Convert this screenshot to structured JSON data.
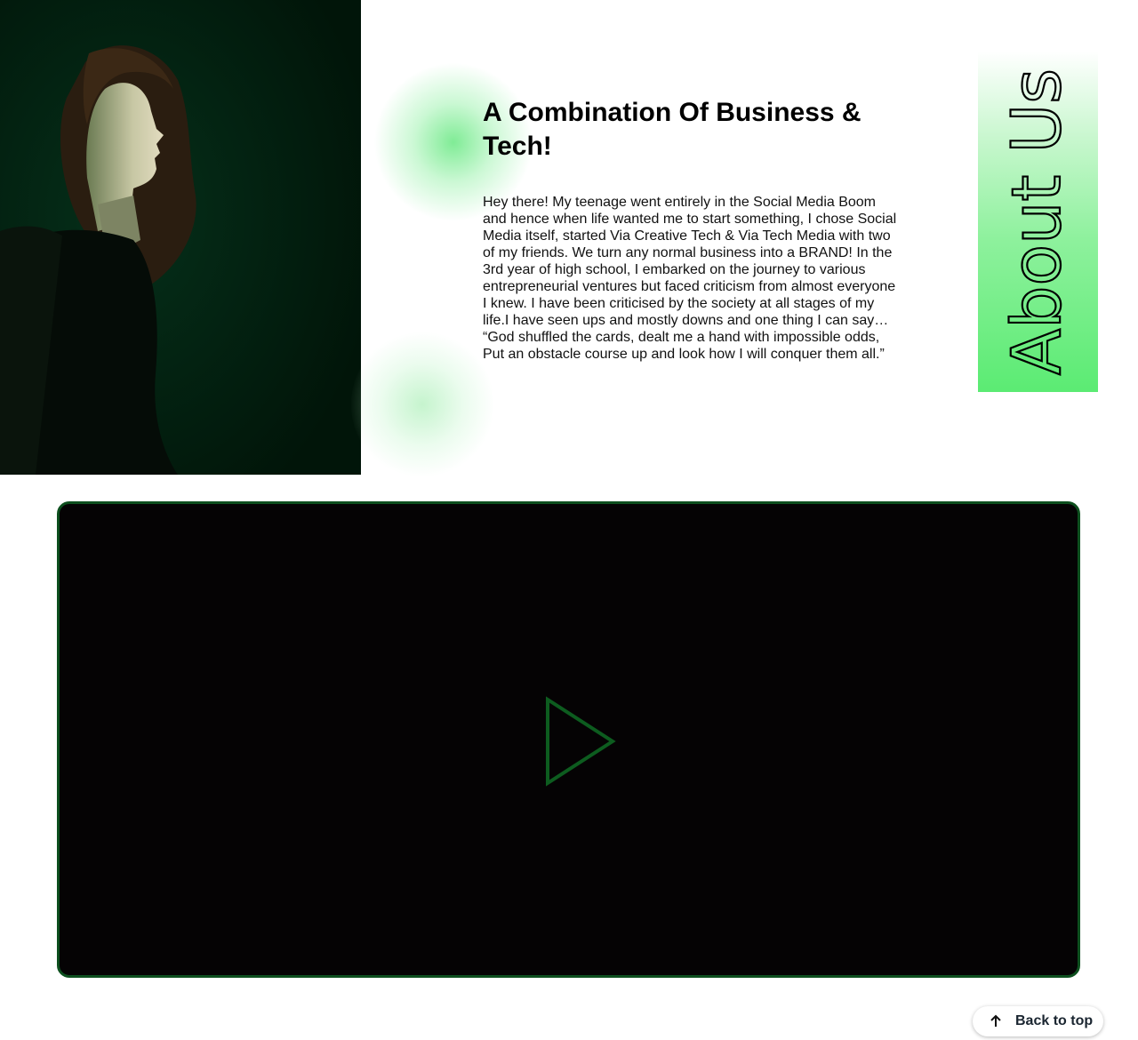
{
  "about": {
    "headline": "A Combination Of Business & Tech!",
    "body": "Hey there! My teenage went entirely in the Social Media Boom and hence when life wanted me to start something, I chose Social Media itself, started Via Creative Tech & Via Tech Media with two of my friends. We turn any normal business into a BRAND! In the 3rd year of high school, I embarked on the journey to various entrepreneurial ventures but faced criticism from almost everyone I knew. I have been criticised by the society at all stages of my life.I have seen ups and mostly downs and one thing I can say… “God shuffled the cards, dealt me a hand with impossible odds, Put an obstacle course up and look how I will conquer them all.”",
    "banner_title": "About Us"
  },
  "video": {
    "play_icon": "play-icon",
    "border_color": "#0d4f1e",
    "background": "#050304"
  },
  "back_to_top": {
    "label": "Back to top",
    "icon": "arrow-up-icon"
  },
  "colors": {
    "accent_green": "#5beb73",
    "play_green": "#0d5c1f",
    "portrait_bg": "#011a0c"
  }
}
